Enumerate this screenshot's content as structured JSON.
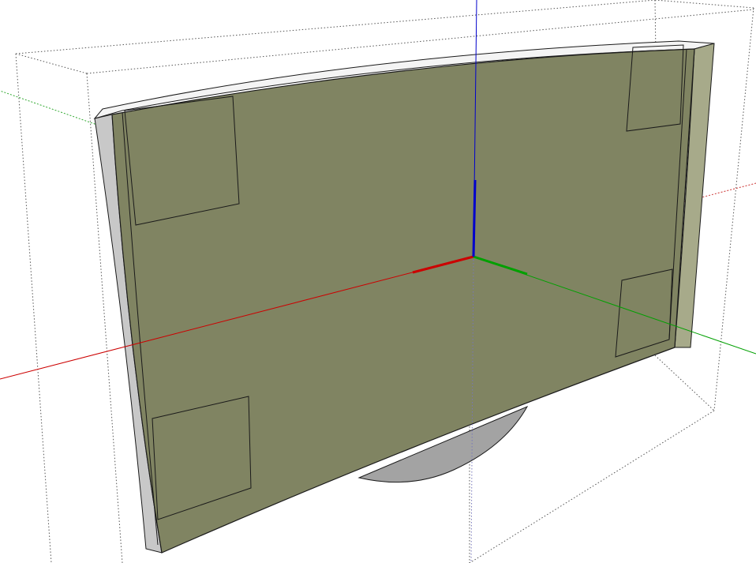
{
  "viewport": {
    "background": "#ffffff",
    "colors": {
      "panel_face": "#808462",
      "panel_edge": "#1a1a1a",
      "bevel_light": "#f2f2f2",
      "bevel_side": "#c8c8c8",
      "stand": "#a3a3a3",
      "bounding_box": "#555555",
      "axis_red": "#cc0000",
      "axis_green": "#00a000",
      "axis_blue": "#0000cc"
    },
    "icons": {
      "axis_origin": "axis-origin-icon"
    }
  }
}
